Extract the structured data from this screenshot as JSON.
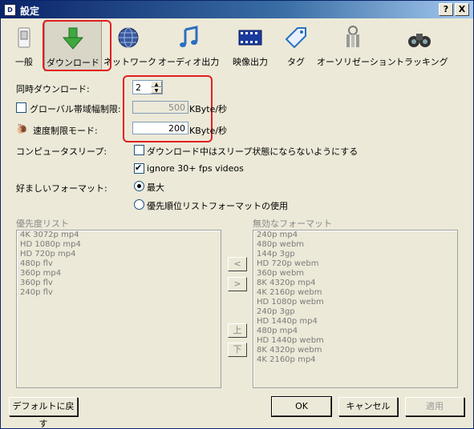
{
  "window": {
    "title": "設定",
    "help_btn": "?",
    "close_btn": "X"
  },
  "toolbar": [
    {
      "label": "一般",
      "icon": "switch-icon"
    },
    {
      "label": "ダウンロード",
      "icon": "download-arrow-icon"
    },
    {
      "label": "ネットワーク",
      "icon": "globe-icon"
    },
    {
      "label": "オーディオ出力",
      "icon": "music-note-icon"
    },
    {
      "label": "映像出力",
      "icon": "film-icon"
    },
    {
      "label": "タグ",
      "icon": "tag-icon"
    },
    {
      "label": "オーソリゼーション",
      "icon": "keys-icon"
    },
    {
      "label": "トラッキング",
      "icon": "binoculars-icon"
    }
  ],
  "settings": {
    "concurrent_label": "同時ダウンロード:",
    "concurrent_value": "2",
    "global_bw_label": "グローバル帯域幅制限:",
    "global_bw_value": "500",
    "global_bw_unit": "KByte/秒",
    "speed_limit_label": "速度制限モード:",
    "speed_limit_value": "200",
    "speed_limit_unit": "KByte/秒",
    "sleep_label": "コンピュータスリープ:",
    "sleep_option": "ダウンロード中はスリープ状態にならないようにする",
    "ignore_fps": "ignore 30+ fps videos",
    "format_label": "好ましいフォーマット:",
    "format_max": "最大",
    "format_priority": "優先順位リストフォーマットの使用"
  },
  "priority_list": {
    "title": "優先度リスト",
    "items": [
      "4K 3072p mp4",
      "HD 1080p mp4",
      "HD 720p mp4",
      "480p flv",
      "360p mp4",
      "360p flv",
      "240p flv"
    ]
  },
  "disabled_list": {
    "title": "無効なフォーマット",
    "items": [
      "240p mp4",
      "480p webm",
      "144p 3gp",
      "HD 720p webm",
      "360p webm",
      "8K 4320p mp4",
      "4K 2160p webm",
      "HD 1080p webm",
      "240p 3gp",
      "HD 1440p mp4",
      "480p mp4",
      "HD 1440p webm",
      "8K 4320p webm",
      "4K 2160p mp4"
    ]
  },
  "mid_buttons": {
    "left": "<",
    "right": ">",
    "up": "上",
    "down": "下"
  },
  "footer": {
    "reset": "デフォルトに戻す",
    "ok": "OK",
    "cancel": "キャンセル",
    "apply": "適用"
  },
  "colors": {
    "highlight": "#e02020",
    "title_bar": "#0a246a",
    "background": "#ece9d8"
  }
}
